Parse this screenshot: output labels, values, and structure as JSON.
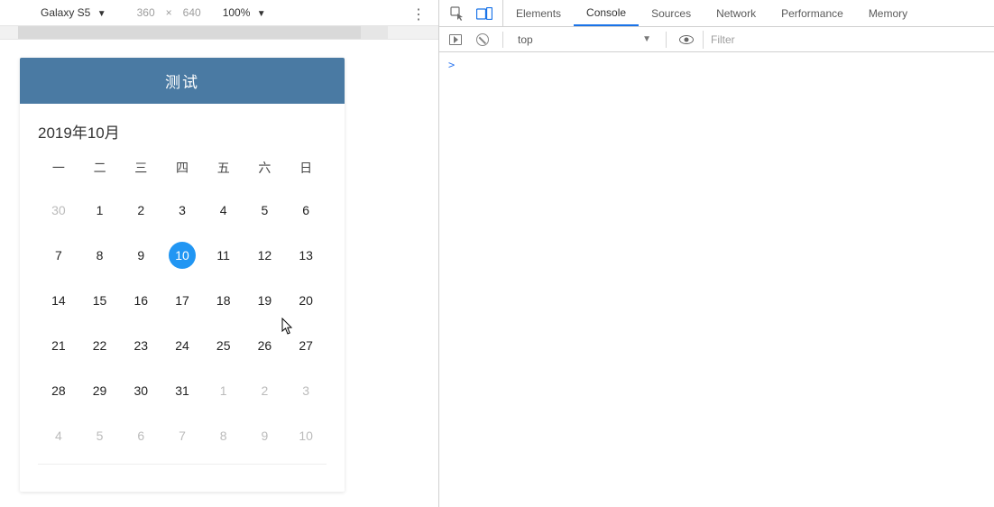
{
  "device_bar": {
    "device": "Galaxy S5",
    "width": "360",
    "sep": "×",
    "height": "640",
    "zoom": "100%"
  },
  "app": {
    "title": "测试"
  },
  "calendar": {
    "title": "2019年10月",
    "weekdays": [
      "一",
      "二",
      "三",
      "四",
      "五",
      "六",
      "日"
    ],
    "days": [
      {
        "n": "30",
        "muted": true
      },
      {
        "n": "1"
      },
      {
        "n": "2"
      },
      {
        "n": "3"
      },
      {
        "n": "4"
      },
      {
        "n": "5"
      },
      {
        "n": "6"
      },
      {
        "n": "7"
      },
      {
        "n": "8"
      },
      {
        "n": "9"
      },
      {
        "n": "10",
        "selected": true
      },
      {
        "n": "11"
      },
      {
        "n": "12"
      },
      {
        "n": "13"
      },
      {
        "n": "14"
      },
      {
        "n": "15"
      },
      {
        "n": "16"
      },
      {
        "n": "17"
      },
      {
        "n": "18"
      },
      {
        "n": "19"
      },
      {
        "n": "20"
      },
      {
        "n": "21"
      },
      {
        "n": "22"
      },
      {
        "n": "23"
      },
      {
        "n": "24"
      },
      {
        "n": "25"
      },
      {
        "n": "26"
      },
      {
        "n": "27"
      },
      {
        "n": "28"
      },
      {
        "n": "29"
      },
      {
        "n": "30"
      },
      {
        "n": "31"
      },
      {
        "n": "1",
        "muted": true
      },
      {
        "n": "2",
        "muted": true
      },
      {
        "n": "3",
        "muted": true
      },
      {
        "n": "4",
        "muted": true
      },
      {
        "n": "5",
        "muted": true
      },
      {
        "n": "6",
        "muted": true
      },
      {
        "n": "7",
        "muted": true
      },
      {
        "n": "8",
        "muted": true
      },
      {
        "n": "9",
        "muted": true
      },
      {
        "n": "10",
        "muted": true
      }
    ]
  },
  "devtools": {
    "tabs": [
      "Elements",
      "Console",
      "Sources",
      "Network",
      "Performance",
      "Memory"
    ],
    "active_tab": "Console",
    "context": "top",
    "filter_placeholder": "Filter",
    "prompt": ">"
  }
}
